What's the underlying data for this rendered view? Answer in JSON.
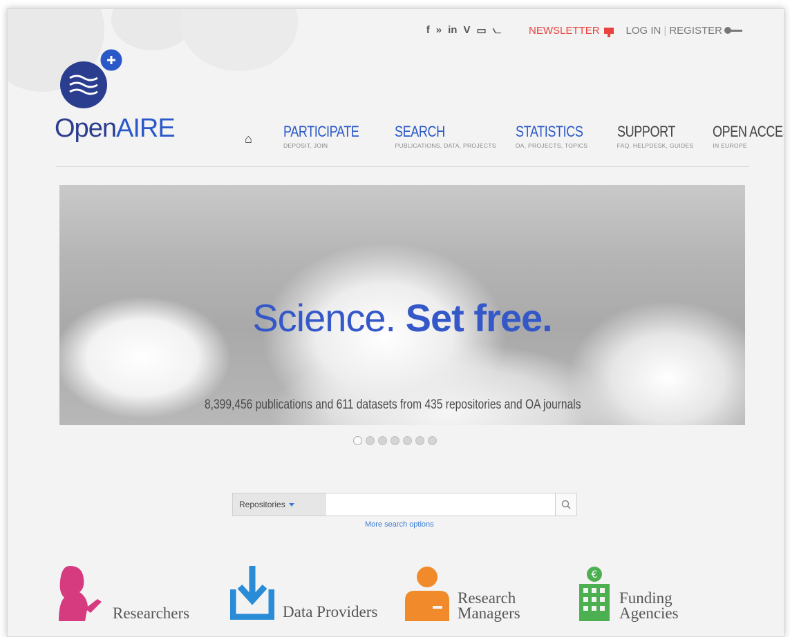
{
  "topbar": {
    "social_icons": [
      "facebook-icon",
      "twitter-icon",
      "linkedin-icon",
      "vimeo-icon",
      "youtube-icon",
      "rss-icon"
    ],
    "social_glyphs": [
      "f",
      "»",
      "in",
      "V",
      "▭",
      "⦦"
    ],
    "newsletter_label": "NEWSLETTER",
    "login_label": "LOG IN",
    "separator": "|",
    "register_label": "REGISTER"
  },
  "logo": {
    "text_open": "Open",
    "text_aire": "AIRE",
    "plus": "+",
    "colors": {
      "primary": "#2b3d8f",
      "accent": "#2b58c9"
    }
  },
  "nav": {
    "home_glyph": "⌂",
    "items": [
      {
        "label": "PARTICIPATE",
        "sub": "DEPOSIT, JOIN"
      },
      {
        "label": "SEARCH",
        "sub": "PUBLICATIONS, DATA, PROJECTS"
      },
      {
        "label": "STATISTICS",
        "sub": "OA, PROJECTS, TOPICS"
      },
      {
        "label": "SUPPORT",
        "sub": "FAQ, HELPDESK, GUIDES"
      },
      {
        "label": "OPEN ACCESS",
        "sub": "IN EUROPE"
      }
    ]
  },
  "hero": {
    "headline_light": "Science. ",
    "headline_bold": "Set free.",
    "stats": "8,399,456 publications and 611 datasets from 435 repositories and OA journals",
    "slide_count": 7,
    "active_slide": 1
  },
  "search": {
    "select_value": "Repositories",
    "input_value": "",
    "placeholder": "",
    "more_options": "More search options"
  },
  "audiences": [
    {
      "label_lines": [
        "Researchers"
      ],
      "color": "#d63a7f",
      "icon": "researcher-icon"
    },
    {
      "label_lines": [
        "Data Providers"
      ],
      "color": "#2a8bd6",
      "icon": "download-icon"
    },
    {
      "label_lines": [
        "Research",
        "Managers"
      ],
      "color": "#f08a2b",
      "icon": "manager-icon"
    },
    {
      "label_lines": [
        "Funding",
        "Agencies"
      ],
      "color": "#4caf50",
      "icon": "building-euro-icon"
    }
  ]
}
